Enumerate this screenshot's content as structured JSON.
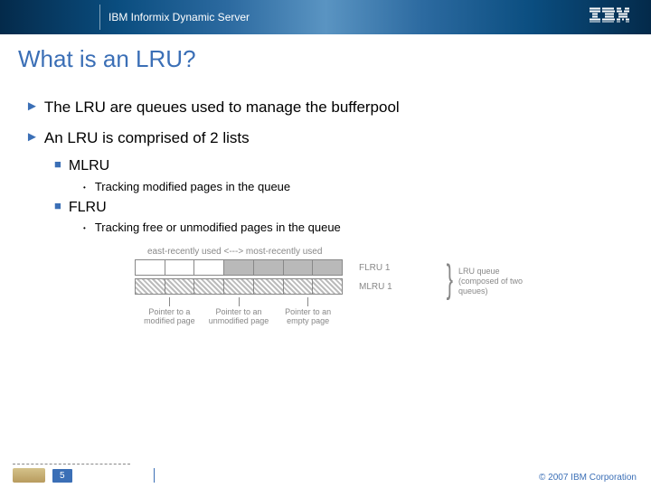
{
  "header": {
    "product": "IBM Informix Dynamic Server",
    "logo_alt": "IBM"
  },
  "title": "What is an LRU?",
  "bullets": {
    "b1": "The LRU are queues used to manage the bufferpool",
    "b2": "An LRU is comprised of 2 lists",
    "b2a": "MLRU",
    "b2a1": "Tracking modified pages in the queue",
    "b2b": "FLRU",
    "b2b1": "Tracking free or unmodified pages in the queue"
  },
  "diagram": {
    "top_label": "east-recently used <---> most-recently used",
    "row1_label": "FLRU 1",
    "row2_label": "MLRU 1",
    "brace_label": "LRU queue (composed of two queues)",
    "callout1": "Pointer to a modified page",
    "callout2": "Pointer to an unmodified page",
    "callout3": "Pointer to an empty page"
  },
  "footer": {
    "page": "5",
    "copyright": "© 2007 IBM Corporation"
  }
}
